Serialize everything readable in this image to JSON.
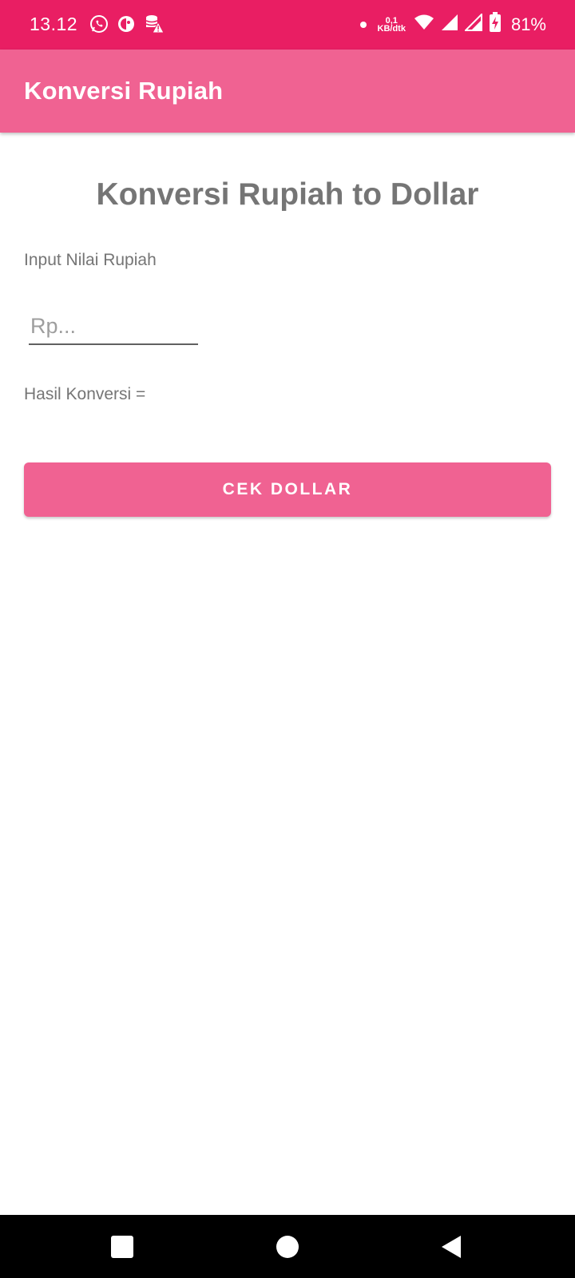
{
  "status_bar": {
    "time": "13.12",
    "net_speed_value": "0,1",
    "net_speed_unit": "KB/dtk",
    "battery": "81%",
    "icons": [
      "whatsapp-icon",
      "app-notification-icon",
      "data-warning-icon",
      "wifi-icon",
      "signal-icon",
      "signal-icon-2",
      "battery-charging-icon"
    ]
  },
  "app_bar": {
    "title": "Konversi Rupiah"
  },
  "main": {
    "heading": "Konversi Rupiah to Dollar",
    "input_label": "Input Nilai Rupiah",
    "input_placeholder": "Rp...",
    "input_value": "",
    "result_label": "Hasil Konversi =",
    "button_label": "CEK DOLLAR"
  },
  "nav_bar": {
    "icons": [
      "recents-icon",
      "home-icon",
      "back-icon"
    ]
  },
  "colors": {
    "status_bar": "#e91e63",
    "app_bar": "#f06292",
    "button": "#f06292",
    "text_gray": "#757575"
  }
}
